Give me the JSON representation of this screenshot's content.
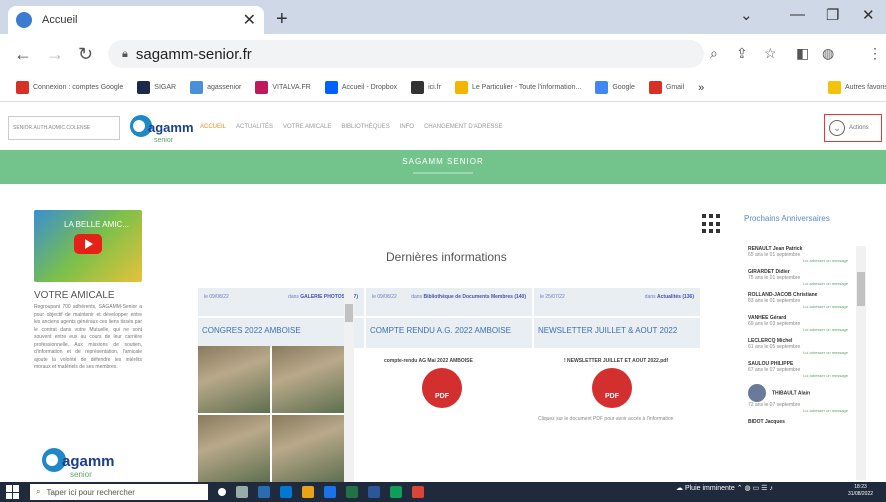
{
  "browser": {
    "tab_title": "Accueil",
    "url": "sagamm-senior.fr",
    "bookmarks": [
      {
        "label": "Connexion : comptes Google",
        "color": "#d93025"
      },
      {
        "label": "SIGAR",
        "color": "#1b2a4a"
      },
      {
        "label": "agassenior",
        "color": "#4a90d9"
      },
      {
        "label": "VITALVA.FR",
        "color": "#c2185b"
      },
      {
        "label": "Accueil - Dropbox",
        "color": "#0061fe"
      },
      {
        "label": "ici.fr",
        "color": "#333333"
      },
      {
        "label": "Le Particulier - Toute l'information...",
        "color": "#f2b600"
      },
      {
        "label": "Google",
        "color": "#4285f4"
      },
      {
        "label": "Gmail",
        "color": "#d93025"
      },
      {
        "label": "»",
        "color": "#ffffff"
      },
      {
        "label": "Autres favoris",
        "color": "#f4c20d"
      }
    ]
  },
  "site": {
    "login_pill": "SENIOR.AUTH.AOMIC.COLENSE",
    "menu": [
      "ACCUEIL",
      "ACTUALITÉS",
      "VOTRE AMICALE",
      "BIBLIOTHÈQUES",
      "INFO",
      "CHANGEMENT D'ADRESSE"
    ],
    "actions_label": "Actions",
    "banner_title": "SAGAMM SENIOR",
    "video_title": "LA BELLE AMIC...",
    "amicale_heading": "VOTRE AMICALE",
    "amicale_text": "Regroupant 700 adhérents, SAGAMM-Senior a pour objectif de maintenir et développer entre les anciens agents généraux ces liens tissés par le contrat dans votre Mutuelle, qui ne sont souvent entre eux au cours de leur carrière professionnelle. Aux missions de soutien, d'information et de représentation, l'amicale ajoute la volonté de défendre les intérêts moraux et matériels de ses membres.",
    "logo_word": "agamm",
    "logo_sub": "senior",
    "dernieres_title": "Dernières informations",
    "cards": [
      {
        "date": "le 09/08/22",
        "cat_prefix": "dans",
        "cat": "GALERIE PHOTOS (147)",
        "title": "CONGRES 2022 AMBOISE"
      },
      {
        "date": "le 09/08/22",
        "cat_prefix": "dans",
        "cat": "Bibliothèque de Documents Membres (140)",
        "title": "COMPTE RENDU A.G. 2022 AMBOISE",
        "pdf_caption": "compte-rendu AG Mai 2022 AMBOISE"
      },
      {
        "date": "le 25/07/22",
        "cat_prefix": "dans",
        "cat": "Actualités (136)",
        "title": "NEWSLETTER JUILLET & AOUT 2022",
        "pdf_caption": "! NEWSLETTER JUILLET ET AOUT 2022.pdf",
        "note": "Cliquez sur le document PDF pour avoir accès à l'information"
      }
    ],
    "pdf_label": "PDF",
    "anniv_heading": "Prochains Anniversaires",
    "anniversaries": [
      {
        "name": "RENAULT Jean Patrick",
        "detail": "65 ans le 01 septembre",
        "link": "Lui adresser un message"
      },
      {
        "name": "GIRARDET Didier",
        "detail": "75 ans le 01 septembre",
        "link": "Lui adresser un message"
      },
      {
        "name": "ROLLAND-JACOB Christiane",
        "detail": "83 ans le 01 septembre",
        "link": "Lui adresser un message"
      },
      {
        "name": "VANHEE Gérard",
        "detail": "69 ans le 03 septembre",
        "link": "Lui adresser un message"
      },
      {
        "name": "LECLERCQ Michel",
        "detail": "61 ans le 05 septembre",
        "link": "Lui adresser un message"
      },
      {
        "name": "SAULOU PHILIPPE",
        "detail": "67 ans le 07 septembre",
        "link": "Lui adresser un message"
      },
      {
        "name": "THIBAULT Alain",
        "detail": "72 ans le 07 septembre",
        "link": "Lui adresser un message"
      },
      {
        "name": "BIDOT Jacques",
        "detail": "",
        "link": ""
      }
    ]
  },
  "taskbar": {
    "search_placeholder": "Taper ici pour rechercher",
    "weather": "Pluie imminente",
    "time": "18:23",
    "date": "31/08/2022"
  }
}
